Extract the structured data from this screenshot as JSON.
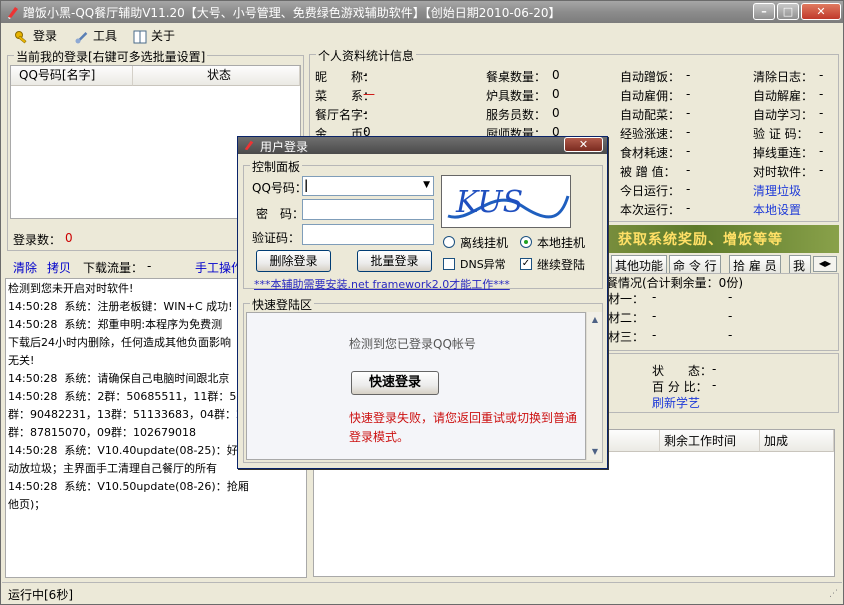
{
  "window": {
    "title": "蹭饭小黑-QQ餐厅辅助V11.20【大号、小号管理、免费绿色游戏辅助软件】【创始日期2010-06-20】"
  },
  "menu": {
    "login": "登录",
    "tools": "工具",
    "about": "关于"
  },
  "accounts": {
    "group_title": "当前我的登录[右键可多选批量设置]",
    "col_qq": "QQ号码[名字]",
    "col_status": "状态",
    "count_label": "登录数：",
    "count_value": "0"
  },
  "toolbar2": {
    "clear": "清除",
    "copy": "拷贝",
    "download_label": "下载流量：",
    "download_value": "-",
    "manual": "手工操作"
  },
  "log": {
    "lines": [
      "检测到您未开启对时软件!",
      "14:50:28  系统：注册老板键：WIN+C 成功!",
      "14:50:28  系统：郑重申明:本程序为免费测",
      "下载后24小时内删除，任何造成其他负面影响",
      "无关!",
      "14:50:28  系统：请确保自己电脑时间跟北京",
      "14:50:28  系统：2群：50685511，11群：510",
      "群：90482231，13群：51133683，04群：2787",
      "群：87815070，09群：102679018",
      "14:50:28  系统：V10.40update(08-25)：好友",
      "动放垃圾；主界面手工清理自己餐厅的所有",
      "14:50:28  系统：V10.50update(08-26)：抢厢",
      "他页)；"
    ]
  },
  "profile": {
    "title": "个人资料统计信息",
    "col1": [
      {
        "label": "昵　　称：",
        "value": "-"
      },
      {
        "label": "菜　　系：",
        "value": "—"
      },
      {
        "label": "餐厅名字：",
        "value": "-"
      },
      {
        "label": "金　　币：",
        "value": "0"
      }
    ],
    "col2": [
      {
        "label": "餐桌数量：",
        "value": "0"
      },
      {
        "label": "炉具数量：",
        "value": "0"
      },
      {
        "label": "服务员数：",
        "value": "0"
      },
      {
        "label": "厨师数量：",
        "value": "0"
      }
    ],
    "col3": [
      {
        "label": "自动蹭饭：",
        "value": "-"
      },
      {
        "label": "自动雇佣：",
        "value": "-"
      },
      {
        "label": "自动配菜：",
        "value": "-"
      },
      {
        "label": "经验涨速：",
        "value": "-"
      },
      {
        "label": "食材耗速：",
        "value": "-"
      },
      {
        "label": "被 蹭 值：",
        "value": "-"
      },
      {
        "label": "今日运行：",
        "value": "-"
      },
      {
        "label": "本次运行：",
        "value": "-"
      }
    ],
    "col4": [
      {
        "label": "清除日志：",
        "value": "-"
      },
      {
        "label": "自动解雇：",
        "value": "-"
      },
      {
        "label": "自动学习：",
        "value": "-"
      },
      {
        "label": "验 证 码：",
        "value": "-"
      },
      {
        "label": "掉线重连：",
        "value": "-"
      },
      {
        "label": "对时软件：",
        "value": "-"
      }
    ],
    "clean_trash": "清理垃圾",
    "local_settings": "本地设置"
  },
  "banner": "、获取系统奖励、增饭等等",
  "tabs": [
    "其他功能",
    "命 令 行",
    "拾 雇 员",
    "我"
  ],
  "food": {
    "title": "餐情况(合计剩余量：0份)",
    "rows": [
      {
        "label": "材一：",
        "v1": "-",
        "v2": "-"
      },
      {
        "label": "材二：",
        "v1": "-",
        "v2": "-"
      },
      {
        "label": "材三：",
        "v1": "-",
        "v2": "-"
      }
    ]
  },
  "study": {
    "status_label": "状　　态：",
    "status_value": "-",
    "percent_label": "百 分 比：",
    "percent_value": "-",
    "refresh": "刷新学艺"
  },
  "work": {
    "col_remaining": "剩余工作时间",
    "col_boost": "加成"
  },
  "dialog": {
    "title": "用户登录",
    "control_panel": "控制面板",
    "qq_label": "QQ号码：",
    "qq_value": "",
    "password_label": "密　码：",
    "captcha_label": "验证码：",
    "captcha_text": "KUS",
    "delete_btn": "删除登录",
    "batch_btn": "批量登录",
    "offline": "离线挂机",
    "local": "本地挂机",
    "dns": "DNS异常",
    "continue": "继续登陆",
    "framework_link": "***本辅助需要安装.net framework2.0才能工作***",
    "quick_area": "快速登陆区",
    "detected": "检测到您已登录QQ帐号",
    "quick_btn": "快速登录",
    "fail_msg_1": "快速登录失败，请您返回重试或切换到普通",
    "fail_msg_2": "登录模式。"
  },
  "statusbar": {
    "text": "运行中[6秒]"
  }
}
